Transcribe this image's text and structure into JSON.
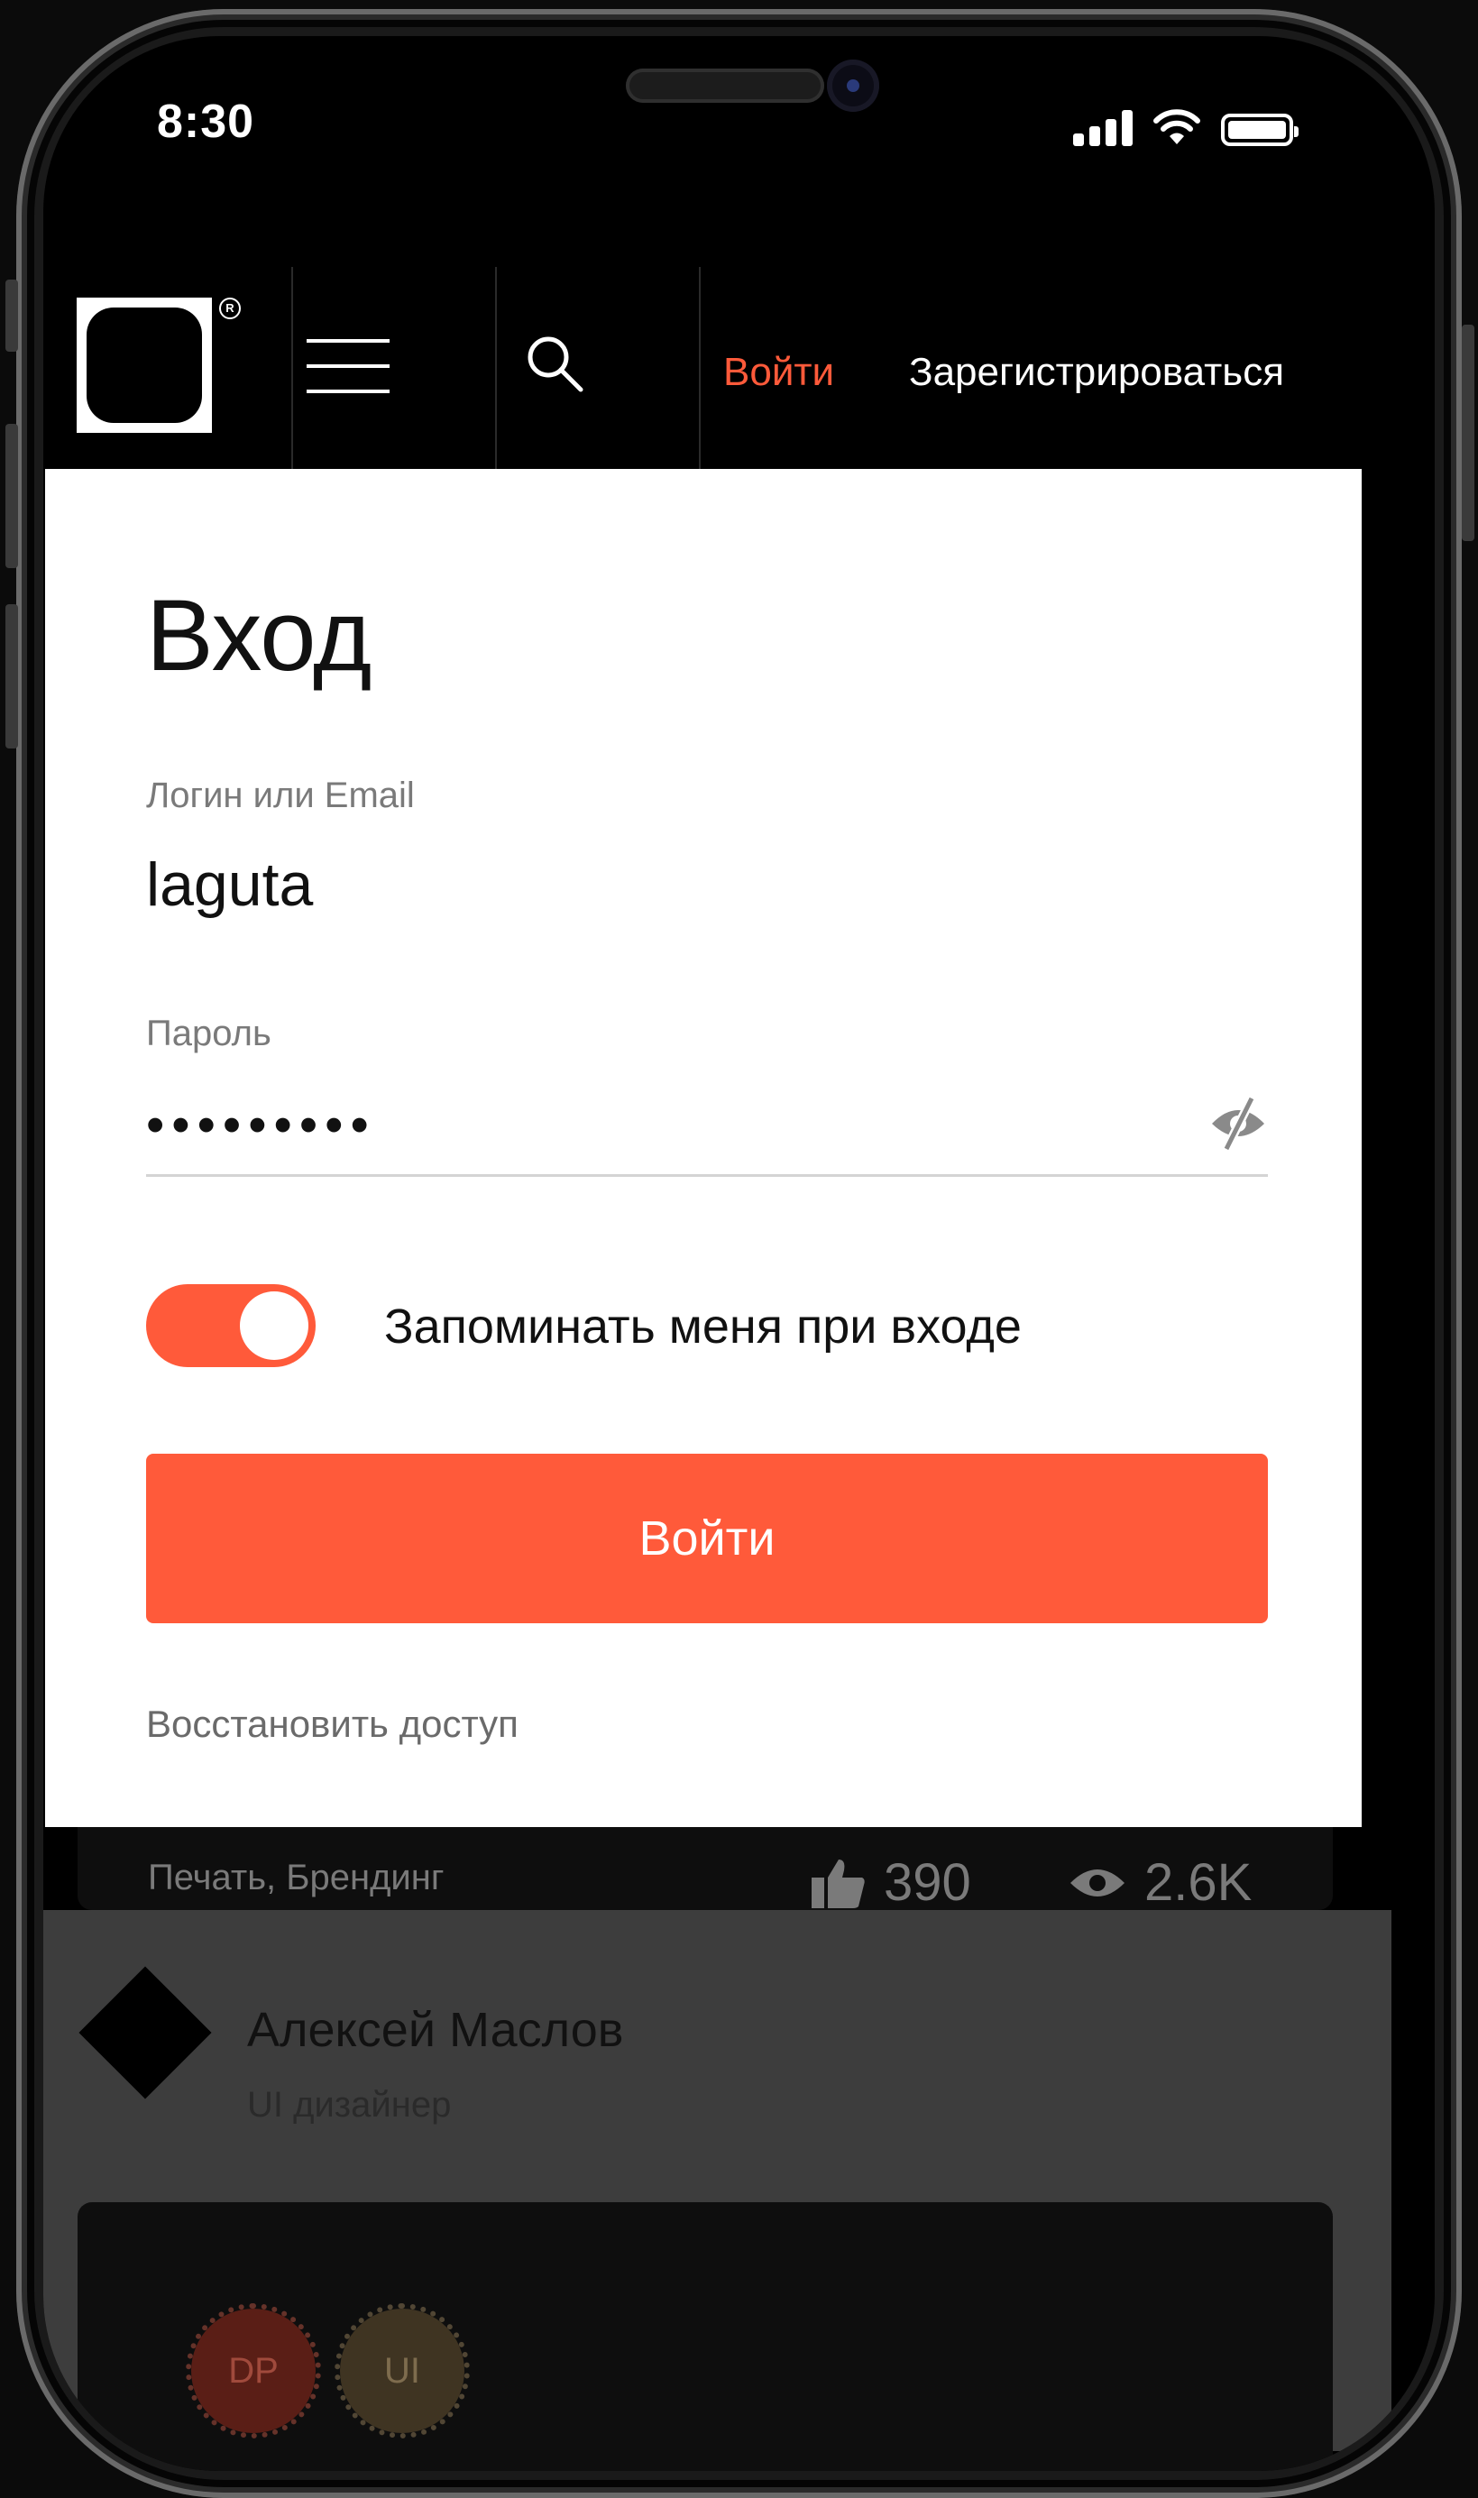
{
  "status_bar": {
    "time": "8:30"
  },
  "header": {
    "login_label": "Войти",
    "register_label": "Зарегистрироваться"
  },
  "login_modal": {
    "title": "Вход",
    "login_field_label": "Логин или Email",
    "login_value": "laguta",
    "password_field_label": "Пароль",
    "password_masked": "•••••••••",
    "remember_me_label": "Запоминать меня при входе",
    "remember_me_on": true,
    "submit_label": "Войти",
    "restore_link": "Восстановить доступ"
  },
  "background_feed": {
    "card_tags": "Печать, Брендинг",
    "likes": "390",
    "views": "2.6K",
    "author_name": "Алексей Маслов",
    "author_role": "UI дизайнер",
    "badges": [
      "DP",
      "UI"
    ]
  },
  "colors": {
    "accent": "#ff5a3a",
    "background": "#000000",
    "modal": "#ffffff"
  },
  "icons": {
    "menu": "hamburger-icon",
    "search": "search-icon",
    "password_visibility": "eye-off-icon",
    "likes": "thumbs-up-icon",
    "views": "eye-icon",
    "signal": "signal-icon",
    "wifi": "wifi-icon",
    "battery": "battery-icon"
  }
}
